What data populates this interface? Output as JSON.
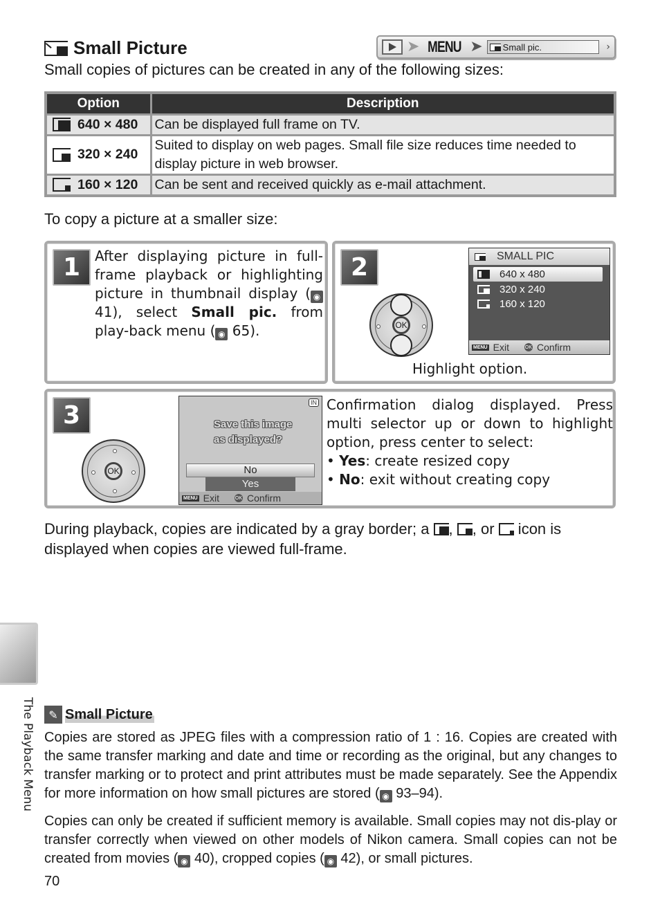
{
  "header": {
    "title": "Small Picture",
    "title_icon": "small-picture-icon",
    "nav_path": {
      "play_icon": "playback-icon",
      "menu_label": "MENU",
      "item_label": "Small pic.",
      "arrow_icon": "arrow-right-icon"
    },
    "intro": "Small copies of pictures can be created in any of the following sizes:"
  },
  "options_table": {
    "columns": [
      "Option",
      "Description"
    ],
    "rows": [
      {
        "icon": "size-640-icon",
        "option": "640 × 480",
        "description": "Can be displayed full frame on TV."
      },
      {
        "icon": "size-320-icon",
        "option": "320 × 240",
        "description": "Suited to display on web pages.  Small file size reduces time needed to display picture in web browser."
      },
      {
        "icon": "size-160-icon",
        "option": "160 × 120",
        "description": "Can be sent and received quickly as e-mail attachment."
      }
    ]
  },
  "copy_lead": "To copy a picture at a smaller size:",
  "steps": [
    {
      "number": "1",
      "text_a": "After displaying picture in full-frame playback or highlighting picture in thumbnail display (",
      "ref1": "41",
      "text_b": "), select ",
      "bold": "Small pic.",
      "text_c": " from play-back menu (",
      "ref2": "65",
      "text_d": ")."
    },
    {
      "number": "2",
      "screen": {
        "title": "SMALL PIC",
        "items": [
          "640 x 480",
          "320 x 240",
          "160 x 120"
        ],
        "selected_index": 0,
        "footer_exit": "Exit",
        "footer_confirm": "Confirm",
        "menu_badge": "MENU",
        "ok_badge": "OK"
      },
      "caption": "Highlight option."
    },
    {
      "number": "3",
      "screen": {
        "badge": "IN",
        "question_line1": "Save this image",
        "question_line2": "as displayed?",
        "option_no": "No",
        "option_yes": "Yes",
        "footer_exit": "Exit",
        "footer_confirm": "Confirm",
        "menu_badge": "MENU",
        "ok_badge": "OK"
      },
      "text": "Confirmation dialog displayed.  Press multi selector up or down to highlight option, press center to select:",
      "bullets": [
        {
          "term": "Yes",
          "desc": ": create resized copy"
        },
        {
          "term": "No",
          "desc": ": exit without creating copy"
        }
      ]
    }
  ],
  "selector": {
    "ok_label": "OK"
  },
  "playback_note": {
    "text_a": "During playback, copies are indicated by a gray border; a ",
    "sep1": ", ",
    "sep2": ", or ",
    "text_b": " icon is displayed when copies are viewed full-frame."
  },
  "side_tab": {
    "label": "The Playback Menu"
  },
  "note": {
    "icon": "paperclip-icon",
    "title": "Small Picture",
    "p1_a": "Copies are stored as JPEG files with a compression ratio of 1 : 16.  Copies are created with the same transfer marking and date and time or recording as the original, but any changes to transfer marking or to protect and print attributes must be made separately. See the Appendix for more information on how small pictures are stored (",
    "p1_ref": "93–94",
    "p1_b": ").",
    "p2_a": "Copies can only be created if sufficient memory is available.  Small copies may not dis-play or transfer correctly when viewed on other models of Nikon camera.   Small copies can not be created from movies (",
    "p2_ref1": "40",
    "p2_b": "), cropped copies (",
    "p2_ref2": "42",
    "p2_c": "), or small pictures."
  },
  "page_number": "70"
}
